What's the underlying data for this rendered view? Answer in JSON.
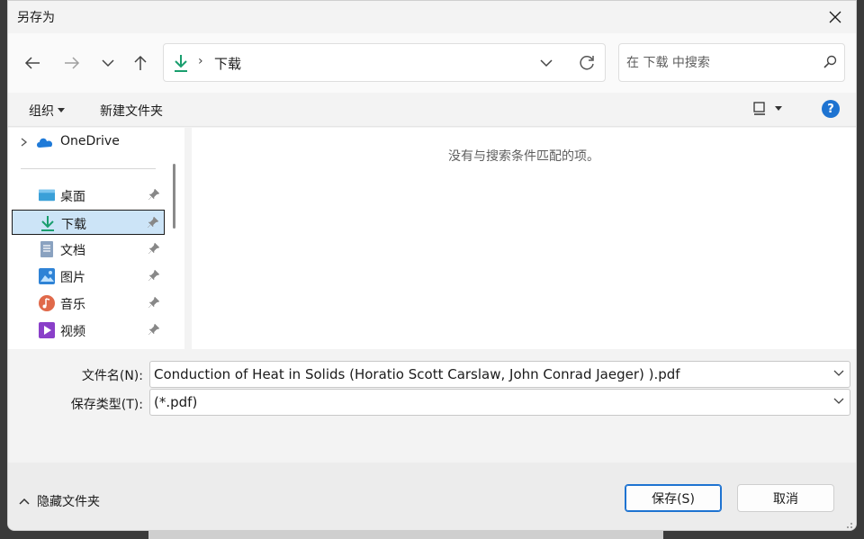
{
  "window": {
    "title": "另存为"
  },
  "address": {
    "crumb": "下载"
  },
  "search": {
    "placeholder": "在 下载 中搜索"
  },
  "toolbar": {
    "organize": "组织",
    "new_folder": "新建文件夹",
    "help": "?"
  },
  "sidebar": {
    "onedrive": "OneDrive",
    "items": [
      {
        "label": "桌面",
        "icon": "desktop-icon"
      },
      {
        "label": "下载",
        "icon": "download-icon",
        "selected": true
      },
      {
        "label": "文档",
        "icon": "document-icon"
      },
      {
        "label": "图片",
        "icon": "pictures-icon"
      },
      {
        "label": "音乐",
        "icon": "music-icon"
      },
      {
        "label": "视频",
        "icon": "video-icon"
      }
    ]
  },
  "content": {
    "empty_message": "没有与搜索条件匹配的项。"
  },
  "form": {
    "filename_label": "文件名(N):",
    "filename_value": "Conduction of Heat in Solids (Horatio Scott Carslaw, John Conrad Jaeger) ).pdf",
    "filetype_label": "保存类型(T):",
    "filetype_value": "(*.pdf)"
  },
  "footer": {
    "hide_folders": "隐藏文件夹",
    "save": "保存(S)",
    "cancel": "取消"
  },
  "colors": {
    "accent": "#1e73d1",
    "download_green": "#1a9e6e",
    "selected_bg": "#cce4f7"
  }
}
